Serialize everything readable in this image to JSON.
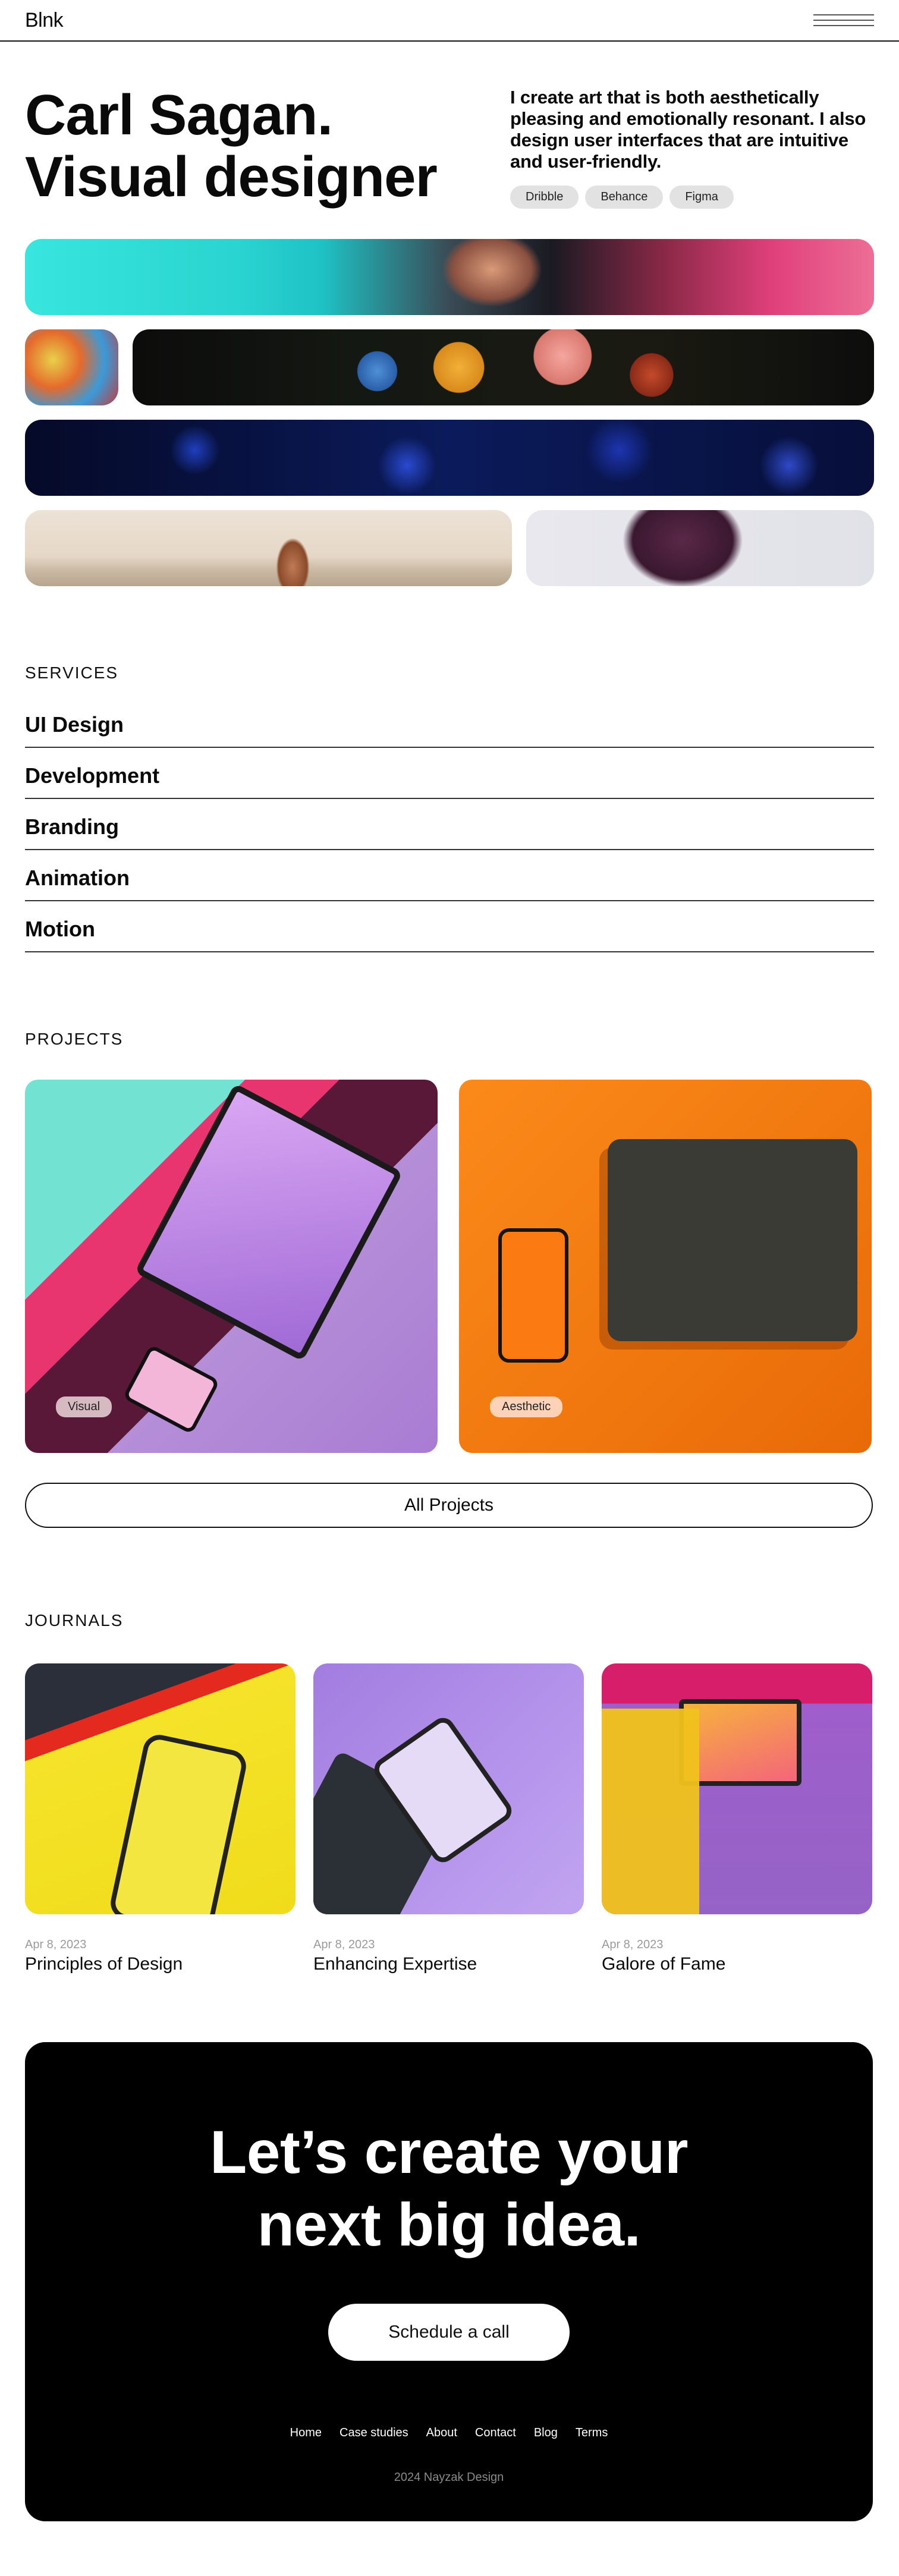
{
  "header": {
    "logo": "Blnk"
  },
  "hero": {
    "title": "Carl Sagan. Visual designer",
    "description": "I create art that is both aesthetically pleasing and emotionally resonant. I also design user interfaces that are intuitive and user-friendly.",
    "pills": [
      "Dribble",
      "Behance",
      "Figma"
    ]
  },
  "services": {
    "label": "SERVICES",
    "items": [
      "UI Design",
      "Development",
      "Branding",
      "Animation",
      "Motion"
    ]
  },
  "projects": {
    "label": "PROJECTS",
    "items": [
      {
        "tag": "Visual"
      },
      {
        "tag": "Aesthetic"
      }
    ],
    "all_button": "All Projects"
  },
  "journals": {
    "label": "JOURNALS",
    "items": [
      {
        "date": "Apr 8, 2023",
        "title": "Principles of Design"
      },
      {
        "date": "Apr 8, 2023",
        "title": "Enhancing Expertise"
      },
      {
        "date": "Apr 8, 2023",
        "title": "Galore of Fame"
      }
    ]
  },
  "cta": {
    "title": "Let’s create your next big idea.",
    "button": "Schedule a call",
    "nav": [
      "Home",
      "Case studies",
      "About",
      "Contact",
      "Blog",
      "Terms"
    ],
    "copyright": "2024 Nayzak Design"
  }
}
